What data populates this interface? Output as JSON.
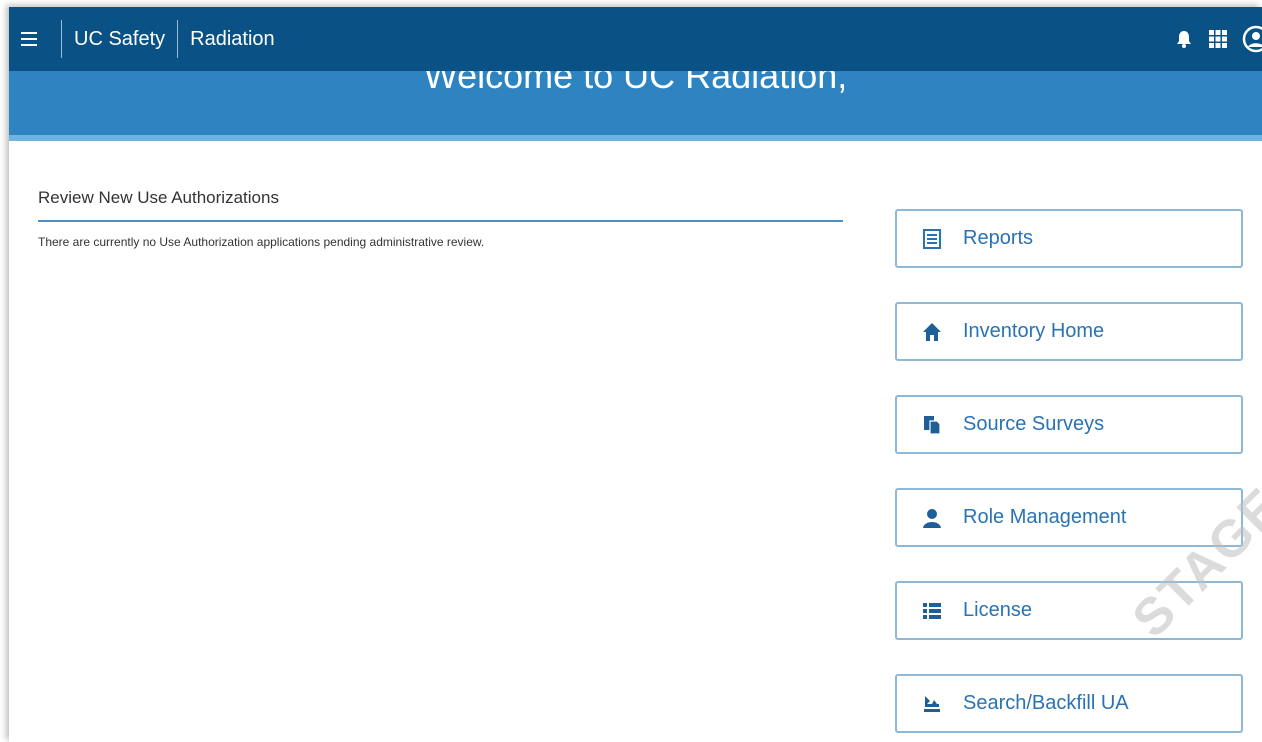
{
  "topbar": {
    "brand": "UC Safety",
    "module": "Radiation",
    "icons": [
      "menu-icon",
      "bell-icon",
      "apps-grid-icon",
      "user-account-icon"
    ],
    "bg_color": "#0a5286"
  },
  "banner": {
    "title": "Welcome to UC Radiation,",
    "bg_color": "#2e84c1"
  },
  "review": {
    "heading": "Review New Use Authorizations",
    "message": "There are currently no Use Authorization applications pending administrative review."
  },
  "nav_buttons": [
    {
      "label": "Reports",
      "icon": "report-icon"
    },
    {
      "label": "Inventory Home",
      "icon": "home-icon"
    },
    {
      "label": "Source Surveys",
      "icon": "documents-icon"
    },
    {
      "label": "Role Management",
      "icon": "person-icon"
    },
    {
      "label": "License",
      "icon": "list-icon"
    },
    {
      "label": "Search/Backfill UA",
      "icon": "flask-search-icon"
    }
  ],
  "watermark": "STAGE",
  "accent_color": "#2a73b3"
}
